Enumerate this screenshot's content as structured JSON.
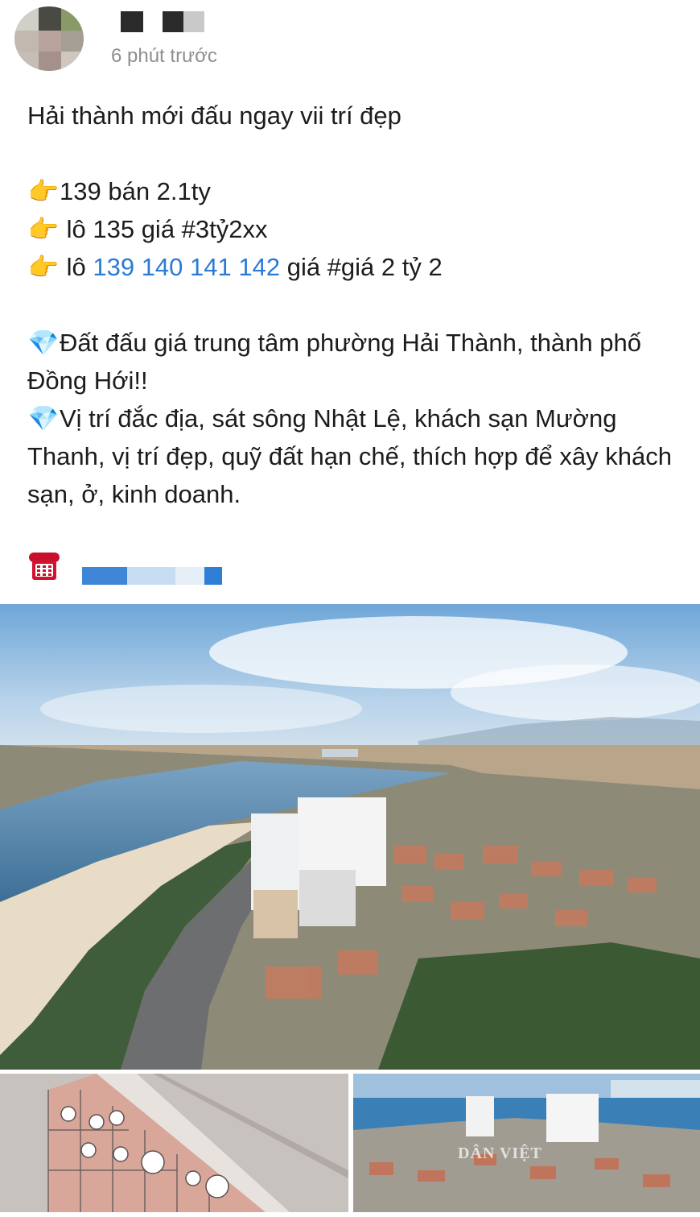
{
  "post": {
    "timestamp": "6 phút trước",
    "lines": {
      "l1": "Hải thành mới đấu ngay vii trí đẹp",
      "l2_emoji": "👉",
      "l2": "139 bán 2.1ty",
      "l3_emoji": "👉",
      "l3": " lô 135 giá #3tỷ2xx",
      "l4_emoji": "👉",
      "l4_pre": " lô ",
      "l4_link": "139 140 141 142",
      "l4_post": " giá #giá 2 tỷ 2",
      "l5_emoji": "💎",
      "l5": "Đất đấu giá trung tâm phường Hải Thành, thành phố Đồng Hới!!",
      "l6_emoji": "💎",
      "l6": "Vị trí đắc địa, sát sông Nhật Lệ, khách sạn Mường Thanh, vị trí đẹp, quỹ đất hạn chế, thích hợp để xây khách sạn, ở, kinh doanh."
    },
    "phone_icon": "telephone-icon"
  },
  "photos": {
    "watermark": "DÂN VIỆT"
  },
  "colors": {
    "link": "#2b7bd6",
    "timestamp": "#8e8e93",
    "text": "#1c1c1e"
  }
}
